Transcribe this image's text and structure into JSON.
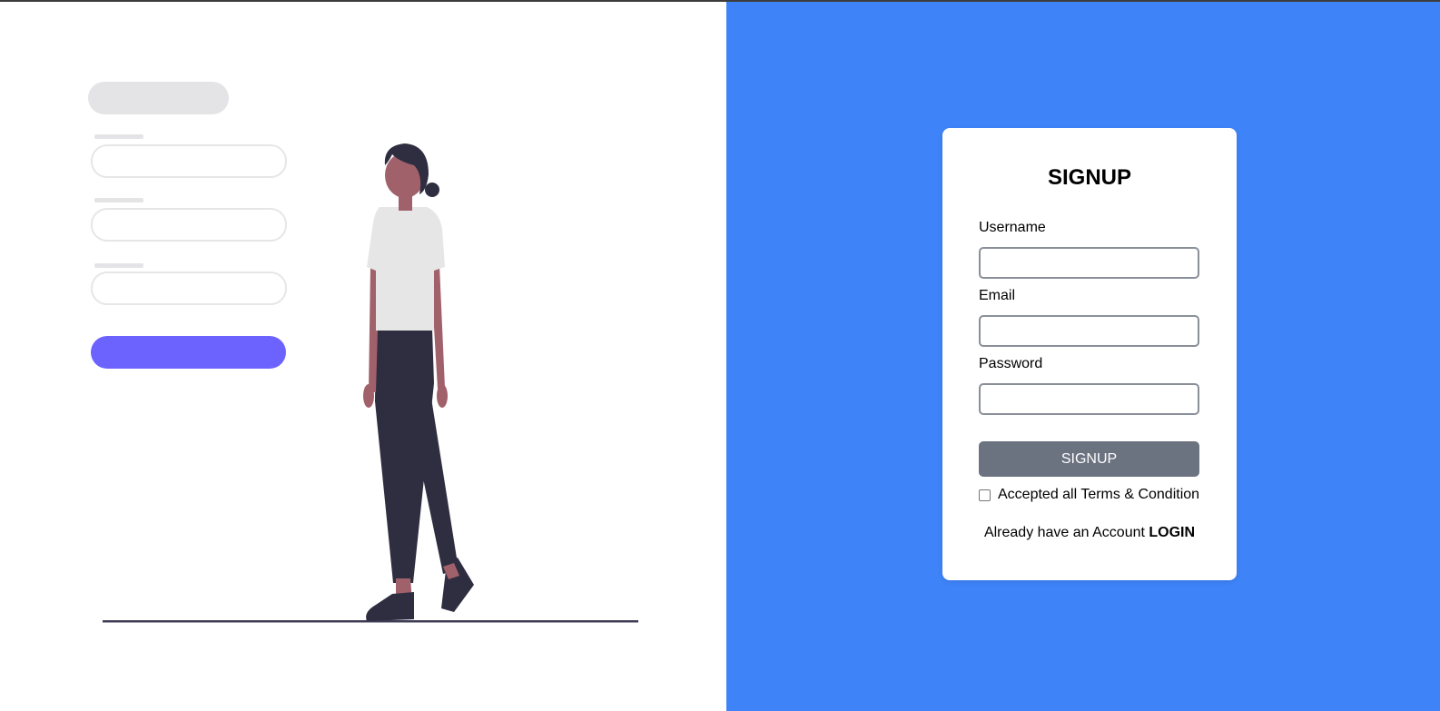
{
  "signup_card": {
    "title": "SIGNUP",
    "fields": [
      {
        "label": "Username",
        "value": "",
        "placeholder": ""
      },
      {
        "label": "Email",
        "value": "",
        "placeholder": ""
      },
      {
        "label": "Password",
        "value": "",
        "placeholder": ""
      }
    ],
    "submit_label": "SIGNUP",
    "terms_label": "Accepted all Terms & Condition",
    "terms_checked": false,
    "login_prompt": "Already have an Account",
    "login_link": "LOGIN"
  },
  "colors": {
    "right_background": "#3e83f7",
    "button_background": "#6b7280",
    "illustration_accent": "#6c63ff",
    "figure_dark": "#2f2e41",
    "figure_skin": "#a0616a"
  },
  "illustration": {
    "icons": [
      "form-placeholder-icon",
      "person-walking-icon"
    ]
  }
}
